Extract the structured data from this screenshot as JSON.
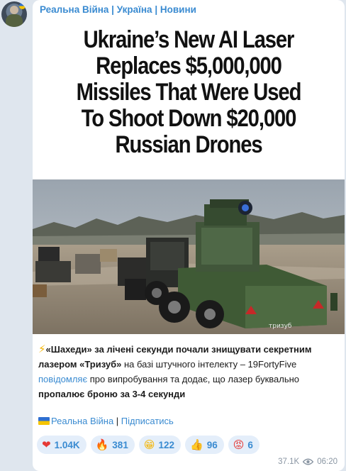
{
  "channel": {
    "name": "Реальна Війна | Україна | Новини"
  },
  "headline": {
    "lines": [
      "Ukraine’s New AI Laser",
      "Replaces $5,000,000",
      "Missiles That Were Used",
      "To Shoot Down $20,000",
      "Russian Drones"
    ]
  },
  "photo": {
    "trailer_text": "тризуб"
  },
  "caption": {
    "emoji": "⚡",
    "part1": "«Шахеди» за лічені секунди почали знищувати секретним лазером «Тризуб»",
    "part2": " на базі штучного інтелекту – 19FortyFive ",
    "link": "повідомляє",
    "part3": " про випробування та додає, що лазер буквально ",
    "part4": "пропалює броню за 3-4 секунди"
  },
  "signature": {
    "channel": "Реальна Війна",
    "separator": " | ",
    "subscribe": "Підписатись"
  },
  "reactions": [
    {
      "emoji": "❤",
      "icon": "heart-icon",
      "count": "1.04K",
      "color": "#e53935"
    },
    {
      "emoji": "🔥",
      "icon": "fire-icon",
      "count": "381",
      "color": "#ff7a00"
    },
    {
      "emoji": "😁",
      "icon": "grin-icon",
      "count": "122",
      "color": "#f4b400"
    },
    {
      "emoji": "👍",
      "icon": "thumbs-up-icon",
      "count": "96",
      "color": "#f4b400"
    },
    {
      "emoji": "😡",
      "icon": "angry-face-icon",
      "count": "6",
      "color": "#e53935"
    }
  ],
  "meta": {
    "views": "37.1K",
    "time": "06:20"
  },
  "colors": {
    "accent": "#3a8bd1",
    "bubble": "#ffffff",
    "background": "#dfe6ee"
  }
}
